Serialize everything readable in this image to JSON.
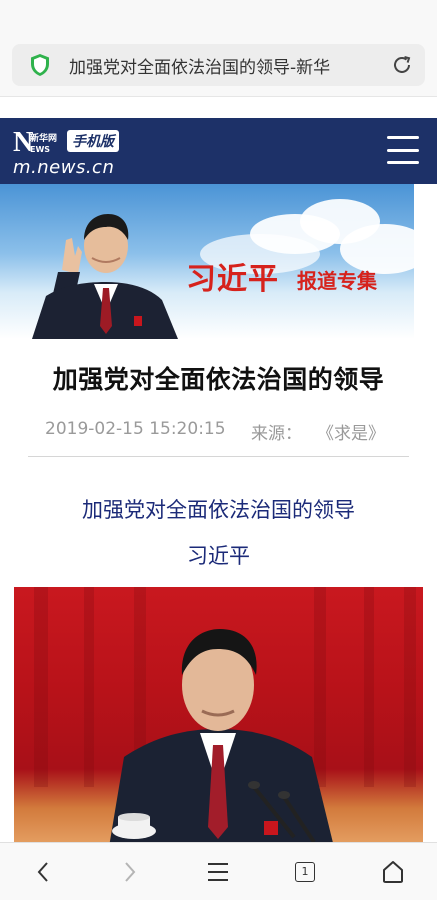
{
  "browser": {
    "url_title": "加强党对全面依法治国的领导-新华",
    "tab_count": "1"
  },
  "site": {
    "logo_n": "N",
    "logo_xinhua": "新华网",
    "logo_ews": "EWS",
    "logo_badge": "手机版",
    "logo_url": "m.news.cn"
  },
  "banner": {
    "name": "习近平",
    "subtitle": "报道专集"
  },
  "article": {
    "title": "加强党对全面依法治国的领导",
    "date": "2019-02-15 15:20:15",
    "source_label": "来源：",
    "source": "《求是》",
    "sub_title": "加强党对全面依法治国的领导",
    "author": "习近平"
  },
  "colors": {
    "header_bg": "#1d3168",
    "banner_accent": "#d6221c",
    "subtitle_color": "#1b2a78",
    "shield_green": "#2fb24c"
  },
  "icons": {
    "security": "shield-check-icon",
    "reload": "reload-icon",
    "menu": "hamburger-menu-icon",
    "back": "chevron-left-icon",
    "forward": "chevron-right-icon",
    "nav_menu": "menu-lines-icon",
    "tabs": "tab-count-icon",
    "home": "home-icon"
  }
}
